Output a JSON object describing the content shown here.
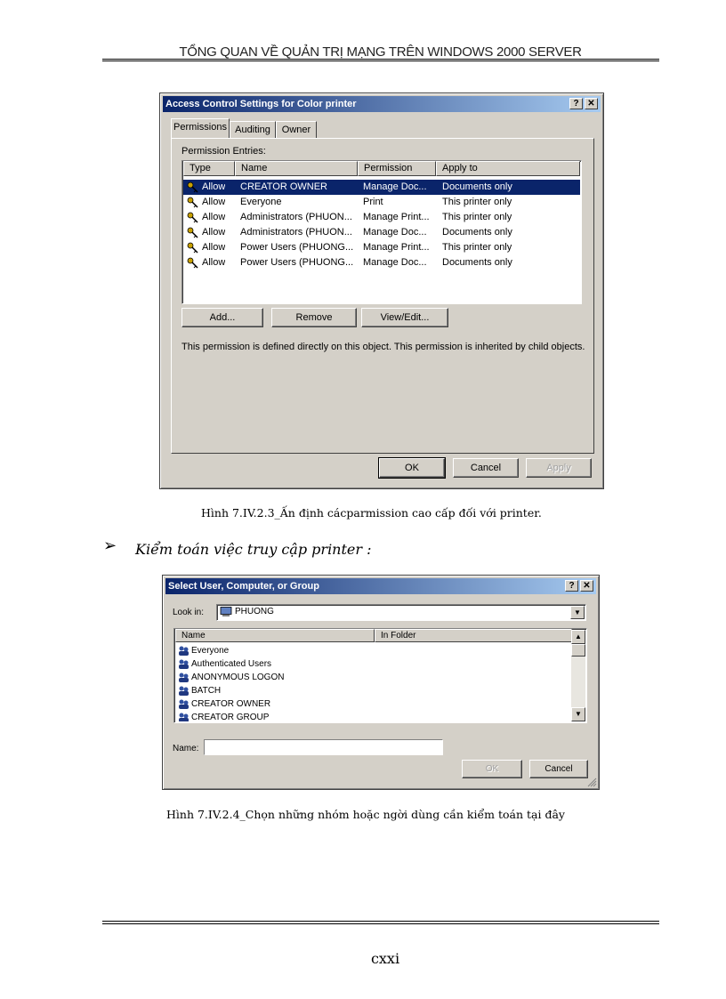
{
  "header": {
    "title": "TỔNG QUAN VỀ QUẢN TRỊ MẠNG TRÊN WINDOWS 2000 SERVER"
  },
  "dialog1": {
    "title": "Access Control Settings for Color printer",
    "help_btn": "?",
    "close_btn": "✕",
    "tabs": [
      "Permissions",
      "Auditing",
      "Owner"
    ],
    "entries_label": "Permission Entries:",
    "columns": [
      "Type",
      "Name",
      "Permission",
      "Apply to"
    ],
    "rows": [
      {
        "type": "Allow",
        "name": "CREATOR OWNER",
        "permission": "Manage Doc...",
        "apply": "Documents only"
      },
      {
        "type": "Allow",
        "name": "Everyone",
        "permission": "Print",
        "apply": "This printer only"
      },
      {
        "type": "Allow",
        "name": "Administrators (PHUON...",
        "permission": "Manage Print...",
        "apply": "This printer only"
      },
      {
        "type": "Allow",
        "name": "Administrators (PHUON...",
        "permission": "Manage Doc...",
        "apply": "Documents only"
      },
      {
        "type": "Allow",
        "name": "Power Users (PHUONG...",
        "permission": "Manage Print...",
        "apply": "This printer only"
      },
      {
        "type": "Allow",
        "name": "Power Users (PHUONG...",
        "permission": "Manage Doc...",
        "apply": "Documents only"
      }
    ],
    "add_btn": "Add...",
    "remove_btn": "Remove",
    "view_btn": "View/Edit...",
    "info_text": "This permission is defined directly on this object. This permission is inherited by child objects.",
    "ok_btn": "OK",
    "cancel_btn": "Cancel",
    "apply_btn": "Apply"
  },
  "caption1": "Hình 7.IV.2.3_Ấn định cácparmission  cao cấp đối với printer.",
  "section": {
    "bullet": "➢",
    "text": "Kiểm toán việc truy cập printer  :"
  },
  "dialog2": {
    "title": "Select User, Computer, or Group",
    "help_btn": "?",
    "close_btn": "✕",
    "lookin_label": "Look in:",
    "lookin_value": "PHUONG",
    "columns": [
      "Name",
      "In Folder"
    ],
    "items": [
      "Everyone",
      "Authenticated Users",
      "ANONYMOUS LOGON",
      "BATCH",
      "CREATOR OWNER",
      "CREATOR GROUP"
    ],
    "name_label": "Name:",
    "name_value": "",
    "ok_btn": "OK",
    "cancel_btn": "Cancel"
  },
  "caption2": "Hình 7.IV.2.4_Chọn những nhóm hoặc ngời   dùng cần kiểm toán tại đây",
  "page_number": "cxxi"
}
